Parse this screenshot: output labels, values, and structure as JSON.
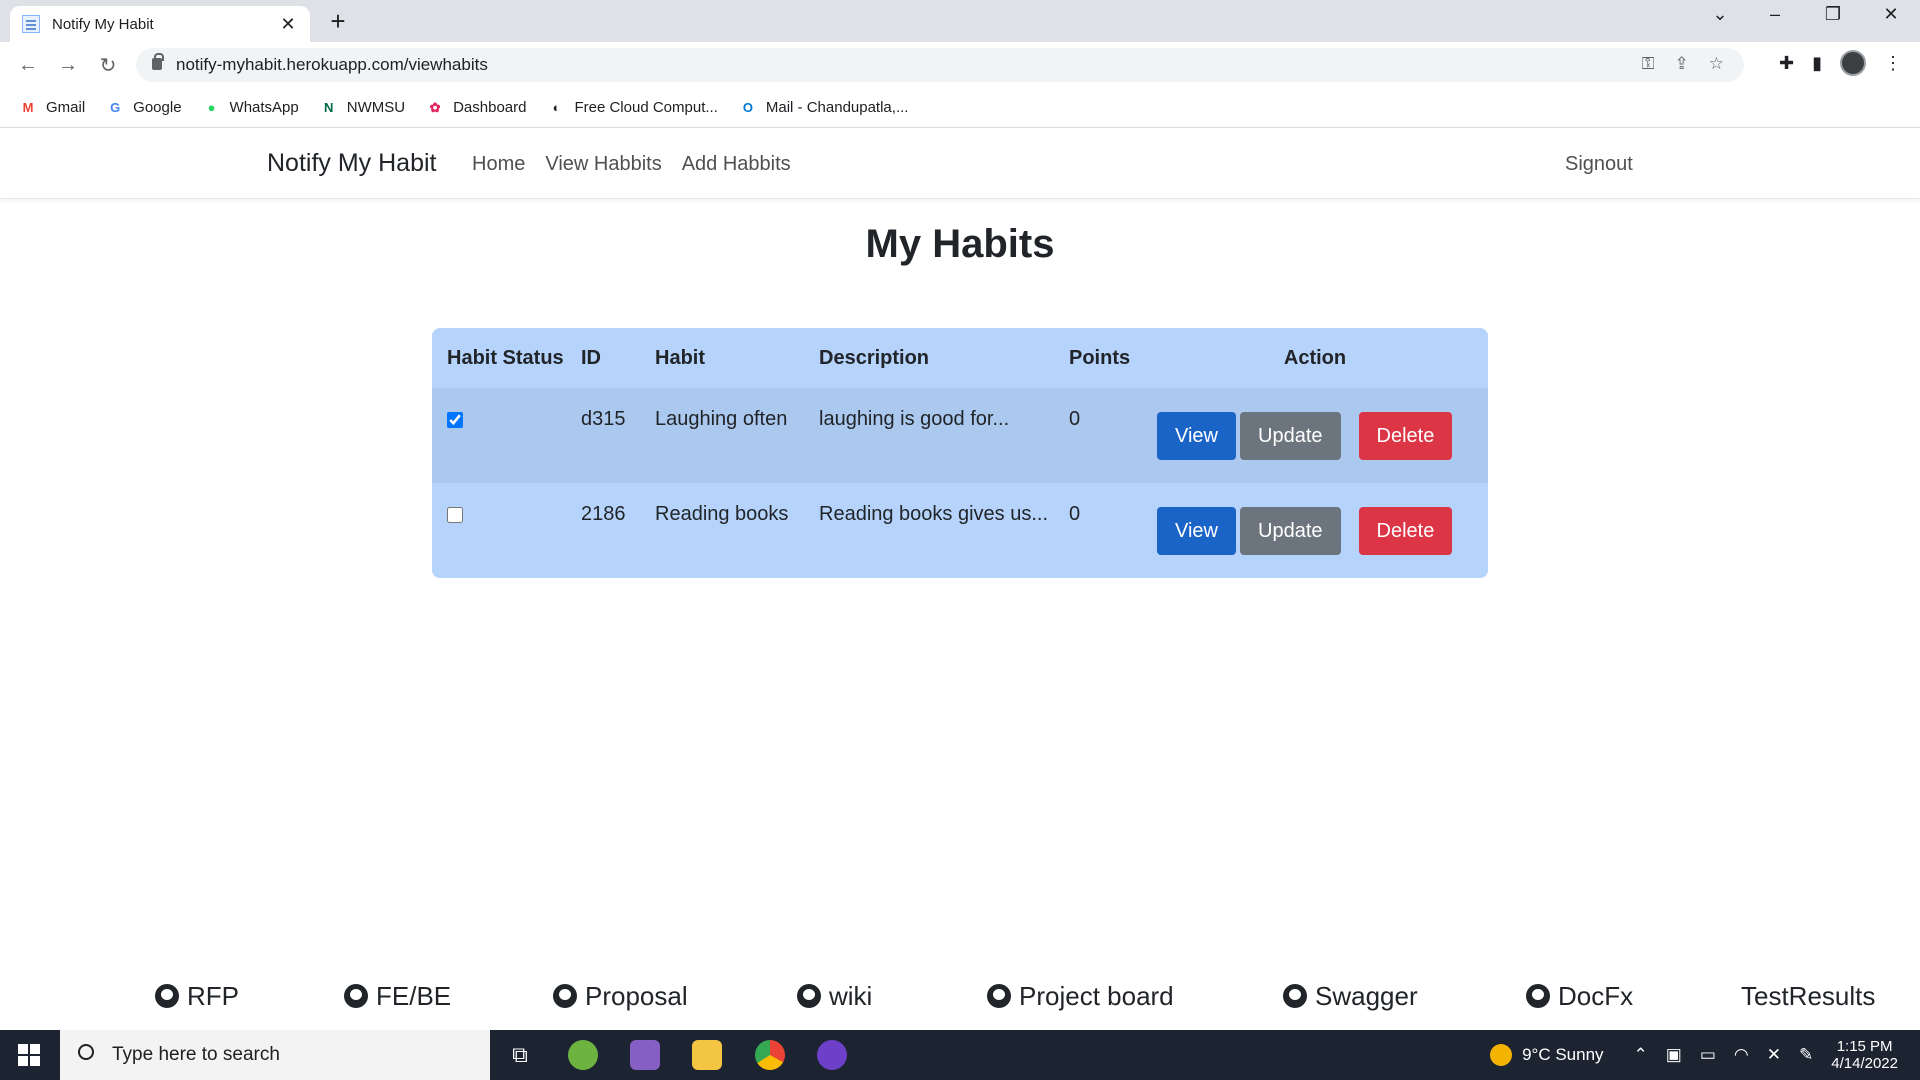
{
  "browser": {
    "tab_title": "Notify My Habit",
    "url": "notify-myhabit.herokuapp.com/viewhabits",
    "bookmarks": [
      {
        "label": "Gmail",
        "icon": "gmail-icon",
        "color": "#ea4335",
        "glyph": "M"
      },
      {
        "label": "Google",
        "icon": "google-icon",
        "color": "#4285f4",
        "glyph": "G"
      },
      {
        "label": "WhatsApp",
        "icon": "whatsapp-icon",
        "color": "#25d366",
        "glyph": "●"
      },
      {
        "label": "NWMSU",
        "icon": "nwmsu-icon",
        "color": "#006747",
        "glyph": "N"
      },
      {
        "label": "Dashboard",
        "icon": "dashboard-icon",
        "color": "#e0245e",
        "glyph": "✿"
      },
      {
        "label": "Free Cloud Comput...",
        "icon": "cloud-icon",
        "color": "#202124",
        "glyph": "◐"
      },
      {
        "label": "Mail - Chandupatla,...",
        "icon": "outlook-icon",
        "color": "#0078d4",
        "glyph": "O"
      }
    ]
  },
  "app": {
    "brand": "Notify My Habit",
    "nav": [
      "Home",
      "View Habbits",
      "Add Habbits"
    ],
    "signout": "Signout",
    "page_title": "My Habits"
  },
  "table": {
    "headers": [
      "Habit Status",
      "ID",
      "Habit",
      "Description",
      "Points",
      "Action"
    ],
    "rows": [
      {
        "checked": true,
        "id": "d315",
        "habit": "Laughing often",
        "description": "laughing is good for...",
        "points": "0"
      },
      {
        "checked": false,
        "id": "2186",
        "habit": "Reading books",
        "description": "Reading books gives us...",
        "points": "0"
      }
    ],
    "actions": {
      "view": "View",
      "update": "Update",
      "delete": "Delete"
    }
  },
  "footer_links": [
    "RFP",
    "FE/BE",
    "Proposal",
    "wiki",
    "Project board",
    "Swagger",
    "DocFx",
    "TestResults"
  ],
  "taskbar": {
    "search_placeholder": "Type here to search",
    "weather": "9°C  Sunny",
    "time": "1:15 PM",
    "date": "4/14/2022"
  },
  "colors": {
    "view": "#1a63c7",
    "update": "#6c757d",
    "delete": "#dc3545",
    "table_bg": "#b6d4fb"
  }
}
